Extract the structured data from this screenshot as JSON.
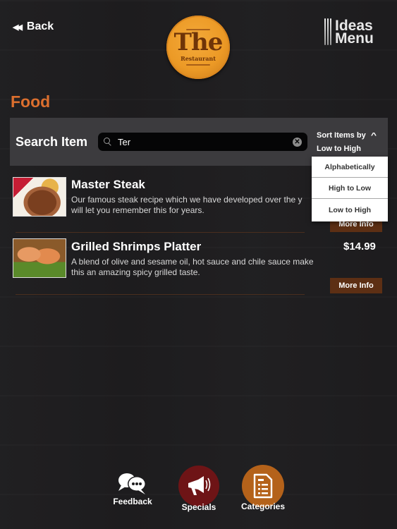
{
  "header": {
    "back_label": "Back",
    "logo_title": "The",
    "logo_subtitle": "Restaurant",
    "brand_line1": "Ideas",
    "brand_line2": "Menu"
  },
  "section_title": "Food",
  "search": {
    "label": "Search Item",
    "value": "Ter",
    "placeholder": ""
  },
  "sort": {
    "label": "Sort Items by",
    "selected": "Low to High",
    "options": [
      "Alphabetically",
      "High to Low",
      "Low to High"
    ]
  },
  "items": [
    {
      "name": "Master Steak",
      "description": "Our famous steak recipe which we have developed over the years will let you remember this for years.",
      "description_line1": "Our famous steak recipe which we have developed over the y",
      "description_line2": "will let you remember this for years.",
      "price": "",
      "more_label": "More Info"
    },
    {
      "name": "Grilled Shrimps Platter",
      "description_line1": "A blend of olive and sesame oil, hot sauce and chile sauce make",
      "description_line2": "this an amazing spicy grilled taste.",
      "price": "$14.99",
      "more_label": "More Info"
    }
  ],
  "bottom_nav": [
    {
      "label": "Feedback",
      "icon": "feedback-icon"
    },
    {
      "label": "Specials",
      "icon": "megaphone-icon",
      "color": "#6e1416"
    },
    {
      "label": "Categories",
      "icon": "document-list-icon",
      "color": "#b4621a"
    }
  ],
  "colors": {
    "accent": "#dc6f2e",
    "button_brown": "#5d2f14",
    "search_panel": "#3c3b3e"
  }
}
